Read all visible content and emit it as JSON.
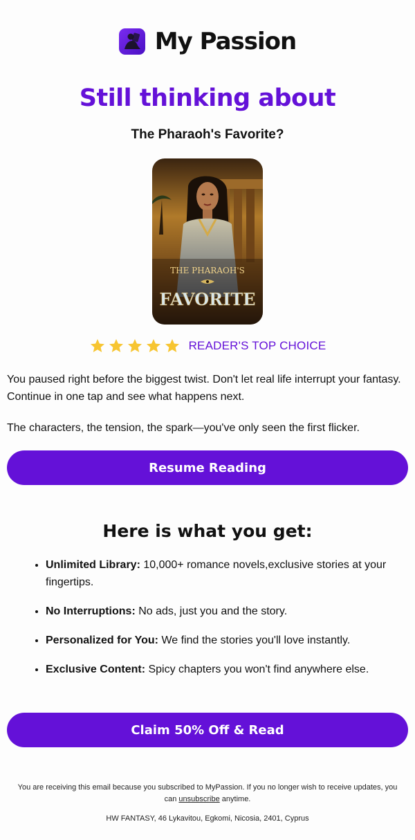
{
  "brand": {
    "name": "My Passion"
  },
  "hero": {
    "headline": "Still thinking about",
    "book_title": "The Pharaoh's Favorite?",
    "cover_line1": "THE PHARAOH'S",
    "cover_line2": "FAVORITE"
  },
  "rating": {
    "stars": 5,
    "label": "READER'S TOP CHOICE"
  },
  "body": {
    "paragraph1": "You paused right before the biggest twist. Don't let real life interrupt your fantasy. Continue in one tap and see what happens next.",
    "paragraph2": "The characters, the tension, the spark—you've only seen the first flicker."
  },
  "cta": {
    "resume_label": "Resume Reading",
    "claim_label": "Claim 50% Off & Read"
  },
  "benefits": {
    "title": "Here is what you get:",
    "items": [
      {
        "bold": "Unlimited Library:",
        "text": " 10,000+ romance novels,exclusive stories at your fingertips."
      },
      {
        "bold": "No Interruptions:",
        "text": " No ads, just you and the story."
      },
      {
        "bold": "Personalized for You:",
        "text": " We find the stories you'll love instantly."
      },
      {
        "bold": "Exclusive Content:",
        "text": " Spicy chapters you won't find anywhere else."
      }
    ]
  },
  "footer": {
    "notice_before": "You are receiving this email because you subscribed to MyPassion. If you no longer wish to receive updates, you can ",
    "unsubscribe_label": "unsubscribe",
    "notice_after": " anytime.",
    "address": "HW FANTASY, 46 Lykavitou, Egkomi, Nicosia, 2401, Cyprus"
  },
  "colors": {
    "accent": "#6411d8",
    "star": "#f7c531",
    "text": "#111111"
  }
}
